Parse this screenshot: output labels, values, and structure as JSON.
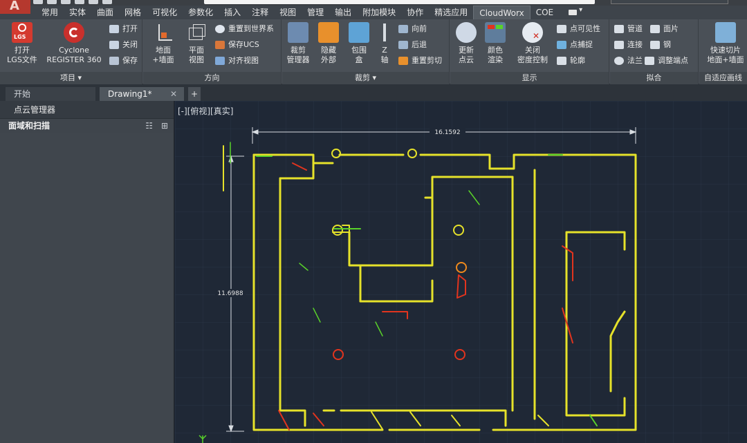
{
  "ribbon_tabs": [
    "常用",
    "实体",
    "曲面",
    "网格",
    "可视化",
    "参数化",
    "插入",
    "注释",
    "视图",
    "管理",
    "输出",
    "附加模块",
    "协作",
    "精选应用",
    "CloudWorx",
    "COE"
  ],
  "ribbon": {
    "project": {
      "title": "项目 ▾",
      "open_lgs": "打开\nLGS文件",
      "lgs_icon_text": "LGS",
      "cyclone": "Cyclone\nREGISTER 360",
      "open": "打开",
      "close": "关闭",
      "save": "保存"
    },
    "orientation": {
      "title": "方向",
      "floor_wall": "地面\n+墙面",
      "plan_view": "平面\n视图",
      "reset_world": "重置到世界系",
      "save_ucs": "保存UCS",
      "align_view": "对齐视图"
    },
    "clip": {
      "title": "裁剪 ▾",
      "clip_manager": "裁剪\n管理器",
      "hide_outside": "隐藏\n外部",
      "box": "包围\n盒",
      "z_axis": "Z\n轴",
      "forward": "向前",
      "backward": "后退",
      "reset_clip": "重置剪切"
    },
    "display": {
      "title": "显示",
      "refresh_cloud": "更新\n点云",
      "color_render": "颜色\n渲染",
      "close_density": "关闭\n密度控制",
      "point_visibility": "点可见性",
      "point_snap": "点捕捉",
      "outline": "轮廓"
    },
    "fit": {
      "title": "拟合",
      "pipe": "管道",
      "patch": "面片",
      "connect": "连接",
      "steel": "钢",
      "flange": "法兰",
      "adjust_end": "调整端点"
    },
    "adaptive": {
      "title": "自适应画线",
      "quick_slice": "快速切片\n地面+墙面"
    }
  },
  "doc_tabs": {
    "start": "开始",
    "drawing": "Drawing1*",
    "close": "✕",
    "add": "+"
  },
  "palette": {
    "title": "点云管理器",
    "section": "面域和扫描",
    "icon_list": "☷",
    "icon_tree": "⊞"
  },
  "viewport": {
    "label": "[-][俯视][真实]",
    "dim_horizontal": "16.1592",
    "dim_vertical": "11.6988"
  },
  "colors": {
    "ribbon_bg": "#4a5057",
    "viewport_bg": "#1f2836",
    "point_yellow": "#e6e22a",
    "point_green": "#59d22a",
    "point_red": "#e2341e",
    "point_orange": "#f08a1c"
  }
}
